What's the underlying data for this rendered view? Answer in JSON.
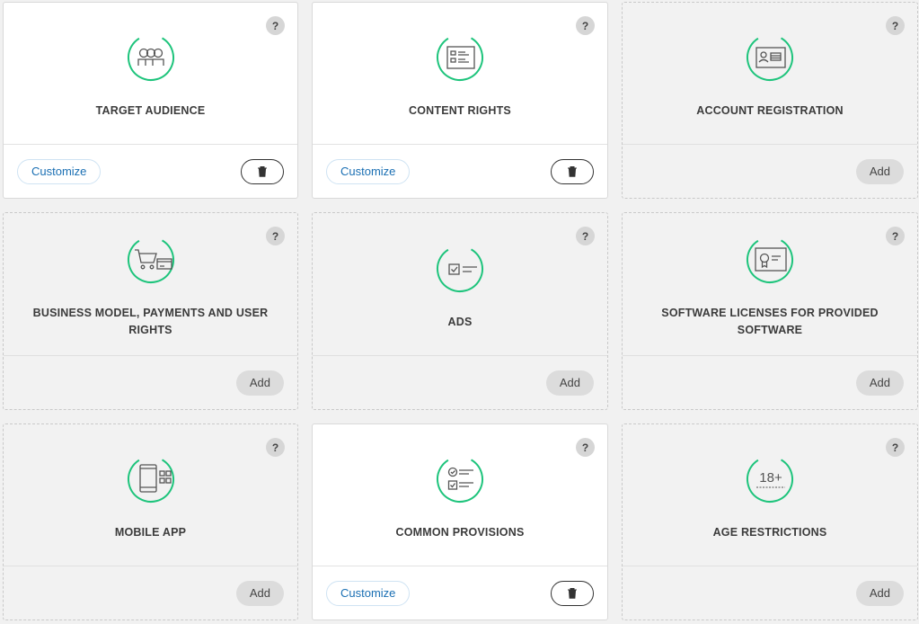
{
  "colors": {
    "accent": "#1ec47c",
    "link": "#1a6fb3",
    "icon_stroke": "#555555"
  },
  "help_label": "?",
  "cards": [
    {
      "title": "TARGET AUDIENCE",
      "state": "active",
      "icon": "audience-icon",
      "customize_label": "Customize"
    },
    {
      "title": "CONTENT RIGHTS",
      "state": "active",
      "icon": "content-rights-icon",
      "customize_label": "Customize"
    },
    {
      "title": "ACCOUNT REGISTRATION",
      "state": "inactive",
      "icon": "id-card-icon",
      "add_label": "Add"
    },
    {
      "title": "BUSINESS MODEL, PAYMENTS AND USER RIGHTS",
      "state": "inactive",
      "icon": "cart-icon",
      "add_label": "Add"
    },
    {
      "title": "ADS",
      "state": "inactive",
      "icon": "ads-icon",
      "add_label": "Add"
    },
    {
      "title": "SOFTWARE LICENSES FOR PROVIDED SOFTWARE",
      "state": "inactive",
      "icon": "certificate-icon",
      "add_label": "Add"
    },
    {
      "title": "MOBILE APP",
      "state": "inactive",
      "icon": "mobile-app-icon",
      "add_label": "Add"
    },
    {
      "title": "COMMON PROVISIONS",
      "state": "active",
      "icon": "checklist-icon",
      "customize_label": "Customize"
    },
    {
      "title": "AGE RESTRICTIONS",
      "state": "inactive",
      "icon": "age-restriction-icon",
      "icon_text": "18+",
      "add_label": "Add"
    }
  ]
}
